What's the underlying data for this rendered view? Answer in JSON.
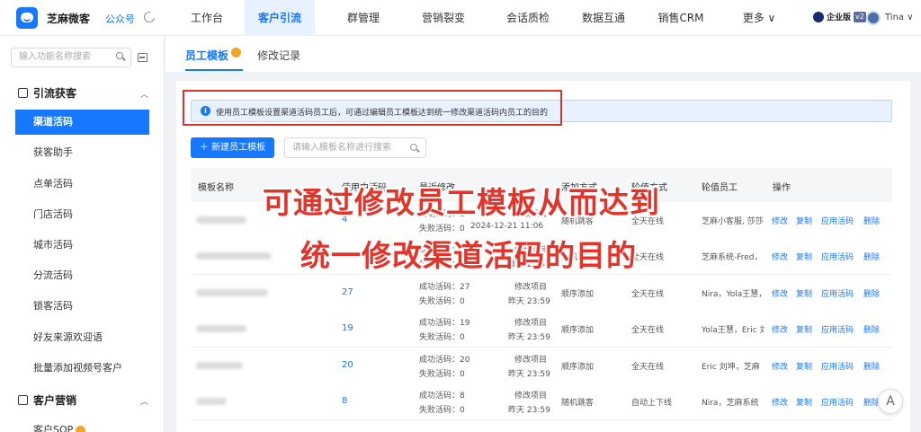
{
  "header": {
    "app_name": "芝麻微客",
    "account_link": "公众号",
    "nav": [
      "工作台",
      "客户引流",
      "群管理",
      "营销裂变",
      "会话质检",
      "数据互通",
      "销售CRM",
      "更多 ∨"
    ],
    "edition_label": "企业版",
    "edition_badge": "v2",
    "user_name": "Tina ∨"
  },
  "sidebar": {
    "search_placeholder": "输入功能名称搜索",
    "group1_title": "引流获客",
    "group1_items": [
      "渠道活码",
      "获客助手",
      "点单活码",
      "门店活码",
      "城市活码",
      "分流活码",
      "锁客活码",
      "好友来源欢迎语",
      "批量添加视频号客户"
    ],
    "group2_title": "客户营销",
    "group2_items": [
      "客户SOP"
    ]
  },
  "tabs": [
    "员工模板",
    "修改记录"
  ],
  "info": {
    "icon": "i",
    "text": "使用员工模板设置渠道活码员工后，可通过编辑员工模板达到统一修改渠道活码内员工的目的"
  },
  "toolbar": {
    "new_button": "＋  新建员工模板",
    "search_placeholder": "请输入模板名称进行搜索"
  },
  "table": {
    "headers": [
      "模板名称",
      "使用中活码",
      "最近修改",
      "添加方式",
      "轮值方式",
      "轮值员工",
      "操作"
    ],
    "rows": [
      {
        "count": "4",
        "success": "成功活码：0",
        "fail": "失败活码：0",
        "mod1": "修改项目",
        "mod2": "2024-12-21 11:06",
        "add": "随机跳客",
        "rotate": "全天在线",
        "staff": "芝麻小客服, 莎莎"
      },
      {
        "count": "10",
        "success": "成功活码：0",
        "fail": "失败活码：0",
        "mod1": "修改项目",
        "mod2": "昨天 23:59",
        "add": "随机跳客",
        "rotate": "全天在线",
        "staff": "芝麻系统-Fred，"
      },
      {
        "count": "27",
        "success": "成功活码：27",
        "fail": "失败活码：0",
        "mod1": "修改项目",
        "mod2": "昨天 23:59",
        "add": "顺序添加",
        "rotate": "全天在线",
        "staff": "Nira，Yola王慧，"
      },
      {
        "count": "19",
        "success": "成功活码：19",
        "fail": "失败活码：0",
        "mod1": "修改项目",
        "mod2": "昨天 23:59",
        "add": "顺序添加",
        "rotate": "全天在线",
        "staff": "Yola王慧，Eric 刘"
      },
      {
        "count": "20",
        "success": "成功活码：20",
        "fail": "失败活码：0",
        "mod1": "修改项目",
        "mod2": "昨天 23:59",
        "add": "顺序添加",
        "rotate": "全天在线",
        "staff": "Eric 刘坤，芝麻"
      },
      {
        "count": "8",
        "success": "成功活码：8",
        "fail": "失败活码：0",
        "mod1": "修改项目",
        "mod2": "昨天 23:59",
        "add": "随机跳客",
        "rotate": "自动上下线",
        "staff": "Nira，芝麻系统"
      }
    ],
    "ops": [
      "修改",
      "复制",
      "应用活码",
      "删除"
    ]
  },
  "overlay": {
    "line1": "可通过修改员工模板从而达到",
    "line2": "统一修改渠道活码的目的"
  },
  "float_button": "A"
}
